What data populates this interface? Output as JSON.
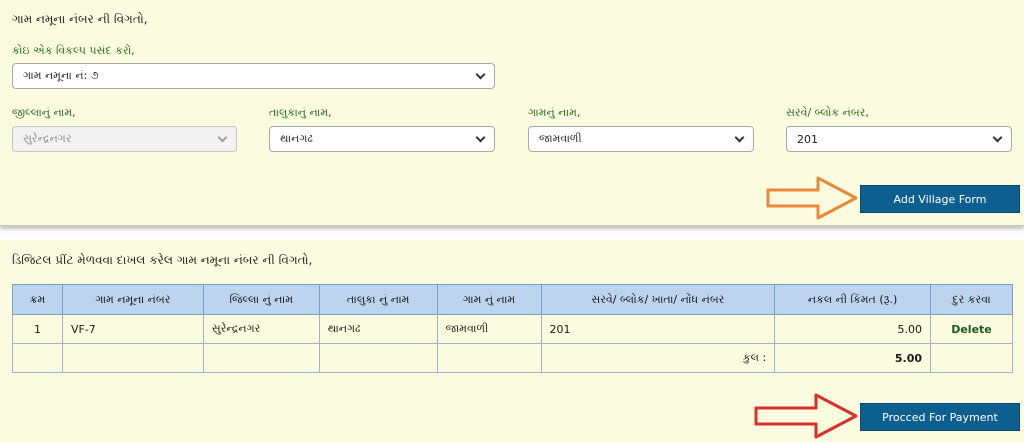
{
  "form_section": {
    "heading": "ગામ નમૂના નંબર ની વિગતો,",
    "option_label": "કોઇ એક વિકલ્પ પસંદ કરો,",
    "option_value": "ગામ નમૂના નં: ૭",
    "district_label": "જીલ્લાનું નામ,",
    "district_value": "સુરેન્દ્રનગર",
    "taluka_label": "તાલુકાનું નામ,",
    "taluka_value": "થાનગઢ",
    "village_label": "ગામનું નામ,",
    "village_value": "જામવાળી",
    "survey_label": "સરવે/ બ્લોક નંબર,",
    "survey_value": "201",
    "add_button": "Add Village Form"
  },
  "list_section": {
    "heading": "ડિજિટલ પ્રીંટ મેળવવા દાખલ કરેલ ગામ નમૂના નંબર ની વિગતો,",
    "columns": [
      "ક્રમ",
      "ગામ નમૂના નંબર",
      "જિલ્લા નું નામ",
      "તાલુકા નું નામ",
      "ગામ નું નામ",
      "સરવે/ બ્લોક/ ખાતા/ નોંધ નંબર",
      "નકલ ની કિંમત (રૂ.)",
      "દુર કરવા"
    ],
    "rows": [
      {
        "sr": "1",
        "form": "VF-7",
        "district": "સુરેન્દ્રનગર",
        "taluka": "થાનગઢ",
        "village": "જામવાળી",
        "survey": "201",
        "price": "5.00",
        "action": "Delete"
      }
    ],
    "total_label": "કુલ :",
    "total_value": "5.00",
    "payment_button": "Procced For Payment"
  },
  "colors": {
    "panel_bg": "#fbfbdf",
    "button_bg": "#0d5f8f",
    "header_bg": "#bcd4ee",
    "arrow_orange": "#e8893a",
    "arrow_red": "#d6312b"
  }
}
